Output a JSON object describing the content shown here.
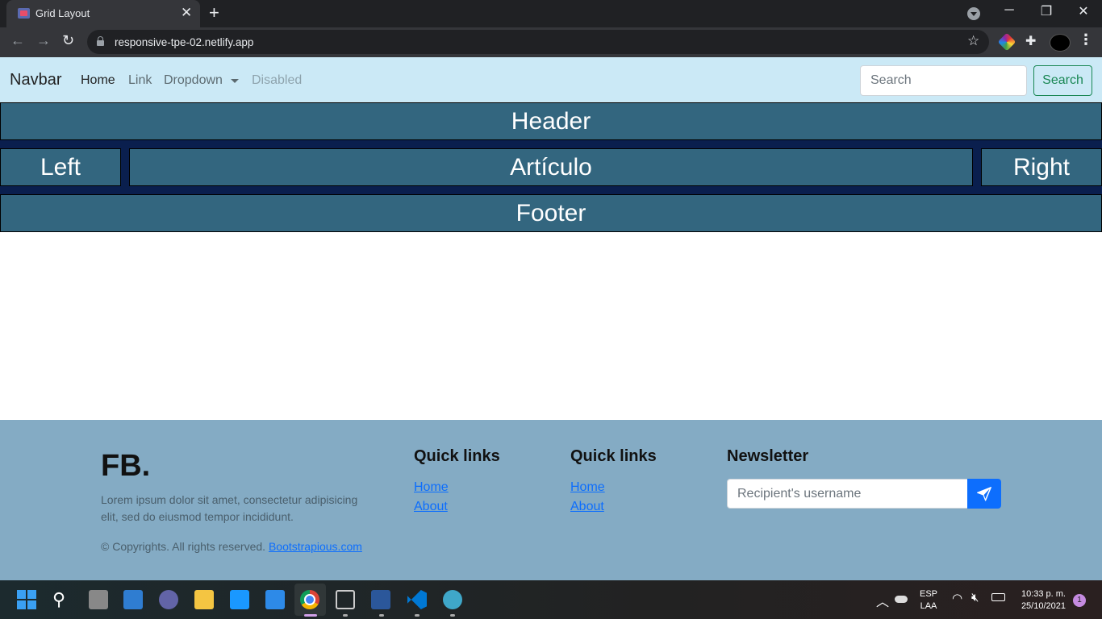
{
  "browser": {
    "tab_title": "Grid Layout",
    "tab_close": "✕",
    "new_tab": "+",
    "url": "responsive-tpe-02.netlify.app",
    "window_controls": {
      "minimize": "─",
      "restore": "❐",
      "close": "✕"
    }
  },
  "navbar": {
    "brand": "Navbar",
    "links": {
      "home": "Home",
      "link": "Link",
      "dropdown": "Dropdown",
      "disabled": "Disabled"
    },
    "search_placeholder": "Search",
    "search_button": "Search"
  },
  "grid": {
    "header": "Header",
    "left": "Left",
    "article": "Artículo",
    "right": "Right",
    "footer": "Footer"
  },
  "footer": {
    "brand": "FB.",
    "description": "Lorem ipsum dolor sit amet, consectetur adipisicing elit, sed do eiusmod tempor incididunt.",
    "copyright_prefix": "© Copyrights. All rights reserved. ",
    "copyright_link": "Bootstrapious.com",
    "columns": [
      {
        "heading": "Quick links",
        "links": [
          "Home",
          "About"
        ]
      },
      {
        "heading": "Quick links",
        "links": [
          "Home",
          "About"
        ]
      }
    ],
    "newsletter": {
      "heading": "Newsletter",
      "placeholder": "Recipient's username"
    }
  },
  "taskbar": {
    "lang_line1": "ESP",
    "lang_line2": "LAA",
    "time": "10:33 p. m.",
    "date": "25/10/2021",
    "notification_count": "1"
  },
  "icons": {
    "back": "back-arrow-icon",
    "forward": "forward-arrow-icon",
    "reload": "reload-icon",
    "lock": "lock-icon",
    "star": "bookmark-star-icon",
    "send": "send-icon"
  },
  "colors": {
    "navbar_bg": "#cbe9f6",
    "grid_cell": "#33667f",
    "grid_bg": "#0a1f4e",
    "footer_bg": "#84abc4",
    "primary": "#0d6efd",
    "success": "#198754"
  }
}
